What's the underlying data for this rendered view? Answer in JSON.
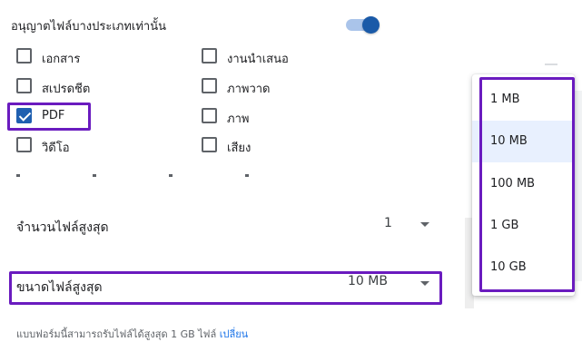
{
  "settings": {
    "title": "อนุญาตไฟล์บางประเภทเท่านั้น",
    "toggle_on": true,
    "file_types": [
      {
        "label": "เอกสาร",
        "checked": false
      },
      {
        "label": "งานนำเสนอ",
        "checked": false
      },
      {
        "label": "สเปรดชีต",
        "checked": false
      },
      {
        "label": "ภาพวาด",
        "checked": false
      },
      {
        "label": "PDF",
        "checked": true
      },
      {
        "label": "ภาพ",
        "checked": false
      },
      {
        "label": "วิดีโอ",
        "checked": false
      },
      {
        "label": "เสียง",
        "checked": false
      }
    ],
    "max_files_label": "จำนวนไฟล์สูงสุด",
    "max_files_value": "1",
    "max_size_label": "ขนาดไฟล์สูงสุด",
    "max_size_value": "10 MB",
    "footer_text": "แบบฟอร์มนี้สามารถรับไฟล์ได้สูงสุด 1 GB ไฟล์",
    "footer_link": "เปลี่ยน"
  },
  "size_dropdown": {
    "options": [
      "1 MB",
      "10 MB",
      "100 MB",
      "1 GB",
      "10 GB"
    ],
    "selected_index": 1
  },
  "colors": {
    "accent": "#1a73e8",
    "checkbox_checked": "#1f5fb0",
    "highlight": "#6a1bbf",
    "toggle_track": "#aac4ea",
    "toggle_knob": "#1a5aa8"
  }
}
